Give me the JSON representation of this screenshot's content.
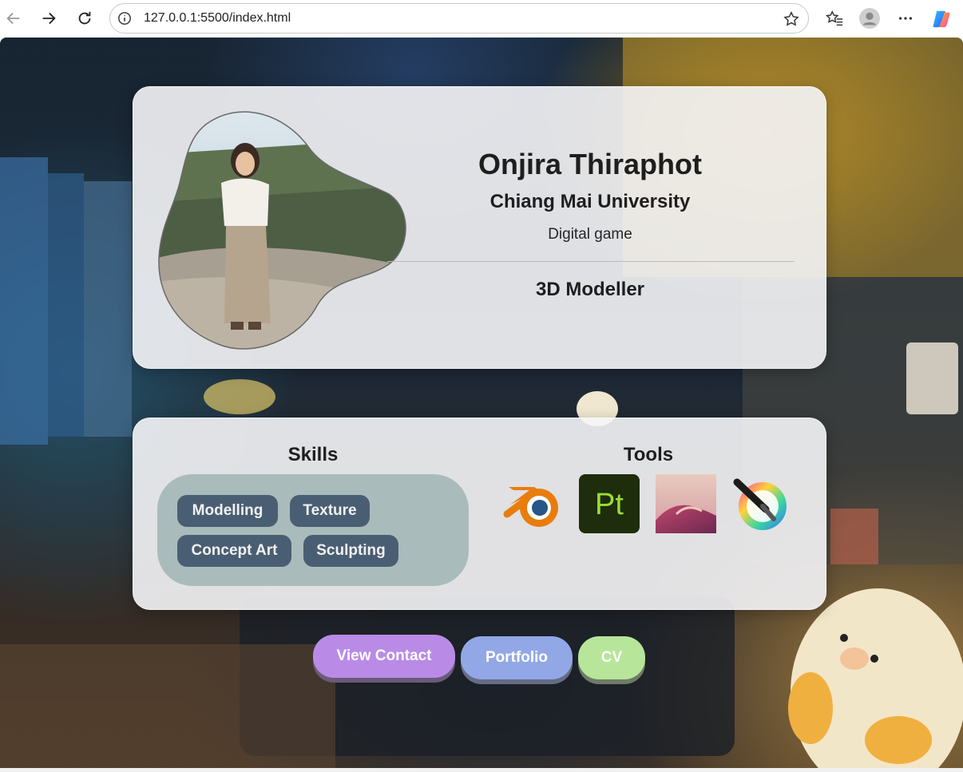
{
  "browser": {
    "url": "127.0.0.1:5500/index.html"
  },
  "profile": {
    "name": "Onjira Thiraphot",
    "university": "Chiang Mai University",
    "major": "Digital game",
    "role": "3D Modeller"
  },
  "skills": {
    "title": "Skills",
    "items": [
      "Modelling",
      "Texture",
      "Concept Art",
      "Sculpting"
    ]
  },
  "tools": {
    "title": "Tools",
    "items": [
      {
        "icon": "blender-icon"
      },
      {
        "icon": "substance-painter-icon",
        "text": "Pt"
      },
      {
        "icon": "dune-app-icon"
      },
      {
        "icon": "krita-icon"
      }
    ]
  },
  "buttons": {
    "contact": "View Contact",
    "portfolio": "Portfolio",
    "cv": "CV"
  },
  "colors": {
    "contact_button": "#b98be6",
    "portfolio_button": "#92a8e6",
    "cv_button": "#b7e59a",
    "skill_chip": "#4a5e73",
    "skills_panel": "#a9bcbb"
  }
}
